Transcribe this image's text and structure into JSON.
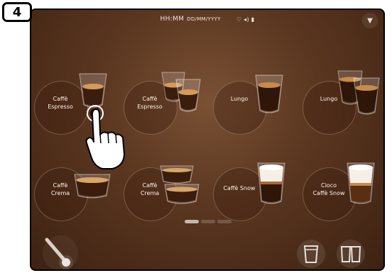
{
  "step": {
    "number": "4"
  },
  "status": {
    "time": "HH:MM",
    "date": "DD/MM/YYYY",
    "icons": "♡ ◂) ▮"
  },
  "menu": {
    "icon": "chevron-down-icon",
    "glyph": "▼"
  },
  "beverages": [
    {
      "line1": "Caffè",
      "line2": "Espresso",
      "cup": "espresso"
    },
    {
      "line1": "Caffè",
      "line2": "Espresso",
      "cup": "double-espresso"
    },
    {
      "line1": "Lungo",
      "line2": "",
      "cup": "lungo"
    },
    {
      "line1": "Lungo",
      "line2": "",
      "cup": "double-lungo"
    },
    {
      "line1": "Caffè",
      "line2": "Crema",
      "cup": "crema"
    },
    {
      "line1": "Caffè",
      "line2": "Crema",
      "cup": "double-crema"
    },
    {
      "line1": "Caffè Snow",
      "line2": "",
      "cup": "snow"
    },
    {
      "line1": "Cioco",
      "line2": "Caffè Snow",
      "cup": "cioco-snow"
    }
  ],
  "pager": {
    "pages": 3,
    "active": 0
  },
  "colors": {
    "background": "#5a3620",
    "text": "#fff4e8",
    "coffee": "#3a1d0c",
    "crema": "#c98a4a",
    "milk": "#f5efe6"
  }
}
